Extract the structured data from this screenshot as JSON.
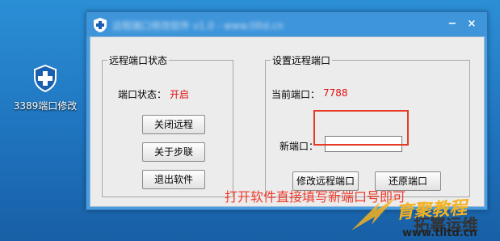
{
  "desktop": {
    "icon_label": "3389端口修改"
  },
  "window": {
    "title": "远程端口修改软件 v1.0 - www.tlltd.cn",
    "minimize_glyph": "−",
    "close_glyph": "×"
  },
  "left_group": {
    "legend": "远程端口状态",
    "status_label": "端口状态：",
    "status_value": "开启",
    "buttons": [
      "关闭远程",
      "关于步联",
      "退出软件"
    ]
  },
  "right_group": {
    "legend": "设置远程端口",
    "current_label": "当前端口：",
    "current_value": "7788",
    "new_label": "新端口：",
    "new_value": "",
    "modify_button": "修改远程端口",
    "restore_button": "还原端口"
  },
  "instruction": "打开软件直接填写新端口号即可",
  "watermark": {
    "text1": "育聚教程",
    "text2": "拓幂运维",
    "url": "www.tlltd.cn"
  },
  "colors": {
    "accent_red": "#e01010",
    "annotation_red": "#ef3a2a",
    "title_blue": "#3f95da"
  },
  "icons": [
    "shield-icon",
    "app-shield-icon",
    "watermark-logo-icon"
  ]
}
